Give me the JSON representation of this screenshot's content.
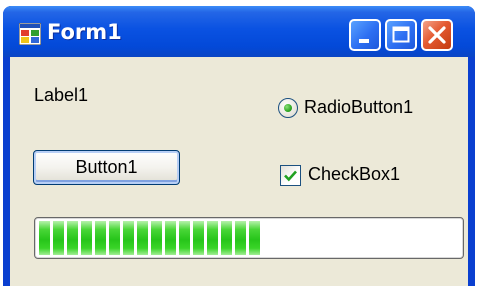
{
  "window": {
    "title": "Form1",
    "app_icon": "form-icon"
  },
  "titlebar_buttons": {
    "minimize": "minimize-icon",
    "maximize": "maximize-icon",
    "close": "close-icon"
  },
  "form": {
    "label1": "Label1",
    "radio_label": "RadioButton1",
    "radio_checked": true,
    "button_label": "Button1",
    "checkbox_label": "CheckBox1",
    "checkbox_checked": true,
    "progress_fraction": 0.55
  },
  "colors": {
    "titlebar": "#0a52e2",
    "client_background": "#ece9d8",
    "progress_green": "#28c41b",
    "close_button": "#e45a32"
  }
}
